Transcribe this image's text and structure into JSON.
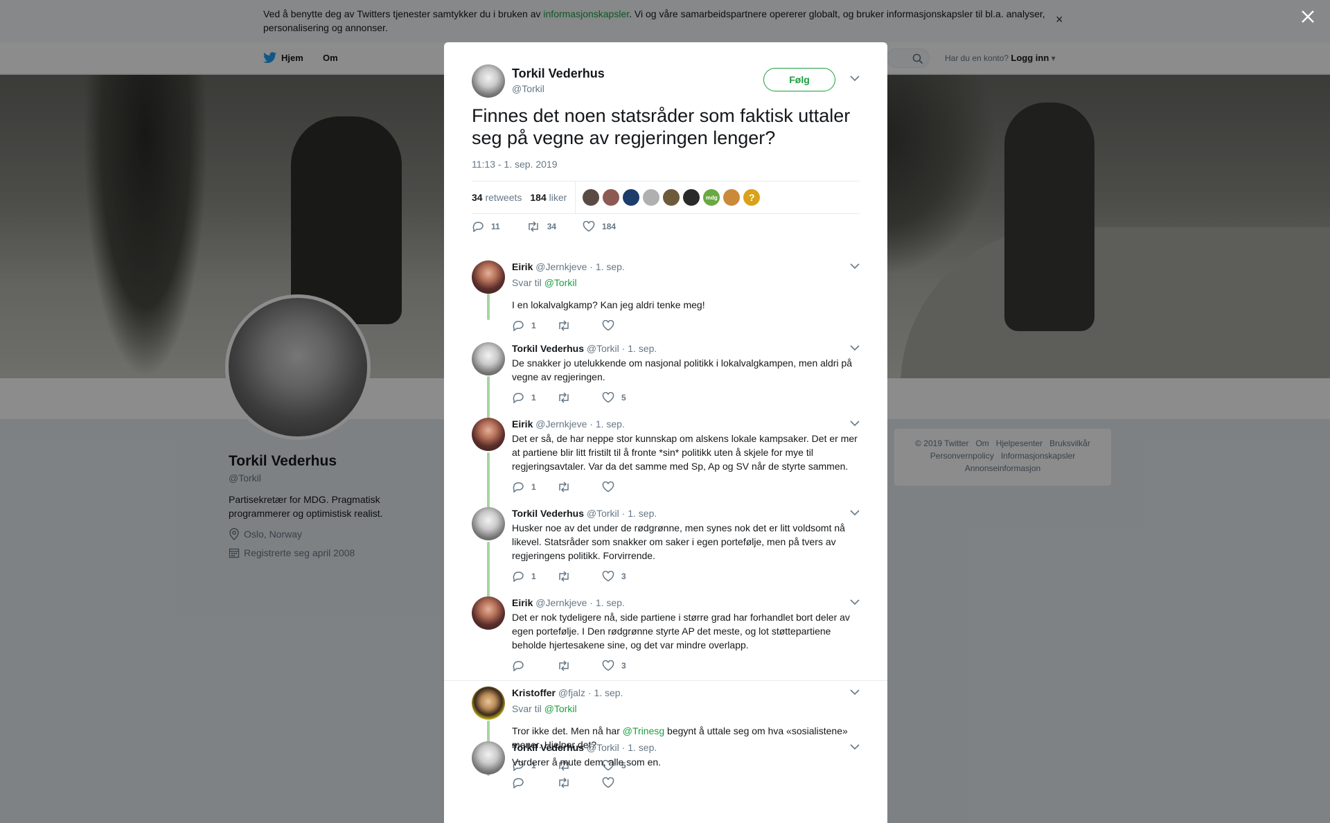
{
  "cookie_bar": {
    "text_before": "Ved å benytte deg av Twitters tjenester samtykker du i bruken av ",
    "link": "informasjonskapsler",
    "text_after": ". Vi og våre samarbeidspartnere opererer globalt, og bruker informasjonskapsler til bl.a. analyser, personalisering og annonser.",
    "close": "×"
  },
  "topnav": {
    "home": "Hjem",
    "about": "Om",
    "login_prompt": "Har du en konto?",
    "login": "Logg inn"
  },
  "profile": {
    "name": "Torkil Vederhus",
    "handle": "@Torkil",
    "bio": "Partisekretær for MDG. Pragmatisk programmerer og optimistisk realist.",
    "location": "Oslo, Norway",
    "joined": "Registrerte seg april 2008"
  },
  "footer": {
    "links": [
      "© 2019 Twitter",
      "Om",
      "Hjelpesenter",
      "Bruksvilkår",
      "Personvernpolicy",
      "Informasjonskapsler",
      "Annonseinformasjon"
    ]
  },
  "tweet": {
    "author_name": "Torkil Vederhus",
    "author_handle": "@Torkil",
    "follow": "Følg",
    "text": "Finnes det noen statsråder som faktisk uttaler seg på vegne av regjeringen lenger?",
    "time": "11:13 - 1. sep. 2019",
    "retweets_count": "34",
    "retweets_label": "retweets",
    "likes_count": "184",
    "likes_label": "liker",
    "likers": [
      {
        "color": "#5a4a44"
      },
      {
        "color": "#8c5a52"
      },
      {
        "color": "#1d3d6b"
      },
      {
        "color": "#b0b0b0"
      },
      {
        "color": "#6d5a3a"
      },
      {
        "color": "#2a2a2a"
      },
      {
        "color": "#6aa842",
        "label": "mdg"
      },
      {
        "color": "#c98a3a"
      },
      {
        "color": "#d9a21c",
        "label": "?"
      }
    ],
    "actions": {
      "replies": "11",
      "retweets": "34",
      "likes": "184"
    }
  },
  "replies": [
    {
      "name": "Eirik",
      "handle": "@Jernkjeve",
      "date": "· 1. sep.",
      "reply_to": "@Torkil",
      "reply_to_label": "Svar til",
      "text": "I en lokalvalgkamp? Kan jeg aldri tenke meg!",
      "replies": "1",
      "retweets": "",
      "likes": "",
      "avatar": "eirik"
    },
    {
      "name": "Torkil Vederhus",
      "handle": "@Torkil",
      "date": "· 1. sep.",
      "text": "De snakker jo utelukkende om nasjonal politikk i lokalvalgkampen, men aldri på vegne av regjeringen.",
      "replies": "1",
      "retweets": "",
      "likes": "5",
      "avatar": "torkil"
    },
    {
      "name": "Eirik",
      "handle": "@Jernkjeve",
      "date": "· 1. sep.",
      "text": "Det er så, de har neppe stor kunnskap om alskens lokale kampsaker. Det er mer at partiene blir litt fristilt til å fronte *sin* politikk uten å skjele for mye til regjeringsavtaler. Var da det samme med Sp, Ap og SV når de styrte sammen.",
      "replies": "1",
      "retweets": "",
      "likes": "",
      "avatar": "eirik"
    },
    {
      "name": "Torkil Vederhus",
      "handle": "@Torkil",
      "date": "· 1. sep.",
      "text": "Husker noe av det under de rødgrønne, men synes nok det er litt voldsomt nå likevel. Statsråder som snakker om saker i egen portefølje, men på tvers av regjeringens politikk. Forvirrende.",
      "replies": "1",
      "retweets": "",
      "likes": "3",
      "avatar": "torkil"
    },
    {
      "name": "Eirik",
      "handle": "@Jernkjeve",
      "date": "· 1. sep.",
      "text": "Det er nok tydeligere nå, side partiene i større grad har forhandlet bort deler av egen portefølje. I Den rødgrønne styrte AP det meste, og lot støttepartiene beholde hjertesakene sine, og det var mindre overlapp.",
      "replies": "",
      "retweets": "",
      "likes": "3",
      "avatar": "eirik"
    },
    {
      "name": "Kristoffer",
      "handle": "@fjalz",
      "date": "· 1. sep.",
      "reply_to": "@Torkil",
      "reply_to_label": "Svar til",
      "text_before": "Tror ikke det. Men nå har ",
      "mention": "@Trinesg",
      "text_after": " begynt å uttale seg om hva «sosialistene» mener. Hjelper det?",
      "replies": "1",
      "retweets": "",
      "likes": "5",
      "avatar": "kristoffer"
    },
    {
      "name": "Torkil Vederhus",
      "handle": "@Torkil",
      "date": "· 1. sep.",
      "text": "Vurderer å mute dem, alle som en.",
      "replies": "",
      "retweets": "",
      "likes": "",
      "avatar": "torkil"
    }
  ],
  "colors": {
    "accent": "#1b9e3e",
    "thread": "#a6d6a1",
    "muted": "#657786"
  }
}
